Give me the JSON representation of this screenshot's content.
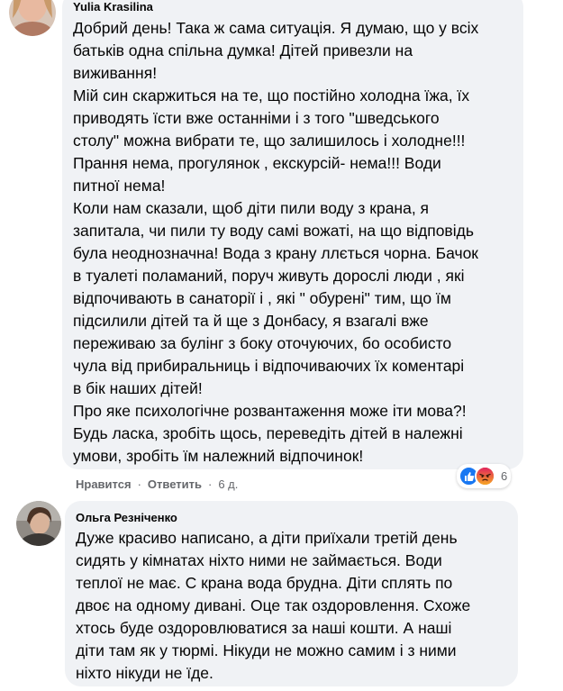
{
  "comments": [
    {
      "author": "Yulia Krasilina",
      "lines": [
        "Добрий день! Така ж сама ситуація. Я думаю, що у всіх",
        "батьків одна спільна думка! Дітей привезли на",
        "виживання!",
        "Мій син скаржиться на те, що постійно холодна їжа, їх",
        "приводять їсти вже останніми і з того \"шведського",
        "столу\" можна вибрати те, що залишилось і холодне!!!",
        "Прання нема, прогулянок , екскурсій- нема!!! Води",
        "питної нема!",
        "Коли нам сказали, щоб діти пили воду з крана, я",
        "запитала, чи пили ту воду самі вожаті, на що відповідь",
        "була неоднозначна! Вода з крану ллється чорна. Бачок",
        "в туалеті поламаний, поруч живуть дорослі люди , які",
        "відпочивають в санаторії і , які \" обурені\" тим, що їм",
        "підсилили дітей та й ще з Донбасу, я взагалі вже",
        "переживаю за булінг з боку оточуючих, бо особисто",
        "чула від прибиральниць і відпочиваючих їх коментарі",
        "в бік наших дітей!",
        "Про яке психологічне розвантаження може іти мова?!",
        "Будь ласка, зробіть щось, переведіть дітей в належні",
        "умови, зробіть їм належний відпочинок!"
      ],
      "actions": {
        "like": "Нравится",
        "reply": "Ответить",
        "time": "6 д."
      },
      "reactions": {
        "icons": [
          "like-icon",
          "angry-icon"
        ],
        "count": "6",
        "colors": {
          "like": "#1877f2",
          "angry": "#e9710f"
        }
      }
    },
    {
      "author": "Ольга Резніченко",
      "lines": [
        "Дуже красиво написано, а діти приїхали третій день",
        "сидять у кімнатах ніхто ними не займається. Води",
        "теплої не має. С крана вода брудна. Діти сплять по",
        "двоє на одному дивані. Оце так оздоровлення. Схоже",
        "хтось буде оздоровлюватися за наші кошти. А наші",
        "діти там як у тюрмі. Нікуди не можно самим і з ними",
        "ніхто нікуди не їде."
      ]
    }
  ],
  "colors": {
    "bubble": "#f0f2f5",
    "text": "#050505",
    "secondary": "#65676b"
  }
}
